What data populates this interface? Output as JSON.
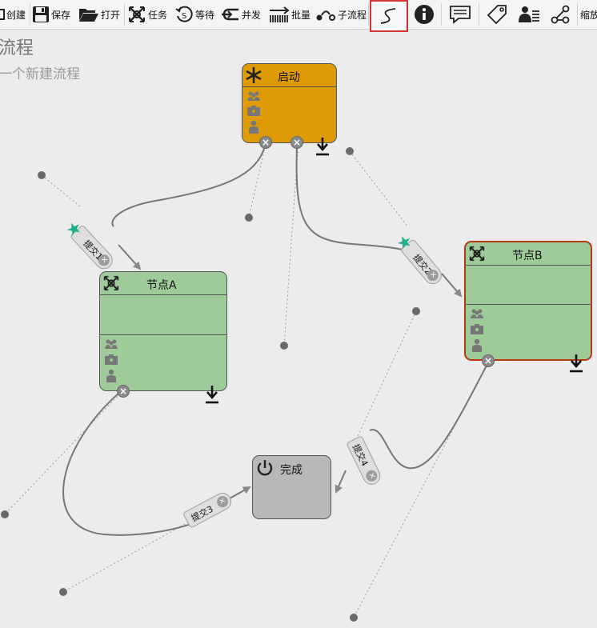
{
  "toolbar": {
    "create": "创建",
    "save": "保存",
    "open": "打开",
    "task": "任务",
    "wait": "等待",
    "fork": "并发",
    "batch": "批量",
    "subprocess": "子流程",
    "zoom": "缩放"
  },
  "process": {
    "name": "流程",
    "description": "一个新建流程"
  },
  "nodes": {
    "start": {
      "title": "启动",
      "color": "#de9b06"
    },
    "node_a": {
      "title": "节点A",
      "color": "#9fcb9b"
    },
    "node_b": {
      "title": "节点B",
      "color": "#9fcb9b",
      "border": "#b23a10"
    },
    "end": {
      "title": "完成",
      "color": "#b8b8b8"
    }
  },
  "edges": {
    "submit1": "提交1",
    "submit2": "提交2",
    "submit3": "提交3",
    "submit4": "提交4"
  },
  "handle_glyph": "×",
  "colors": {
    "active_tool_border": "#d33333",
    "star": "#1fae8c",
    "edge": "#777777"
  }
}
